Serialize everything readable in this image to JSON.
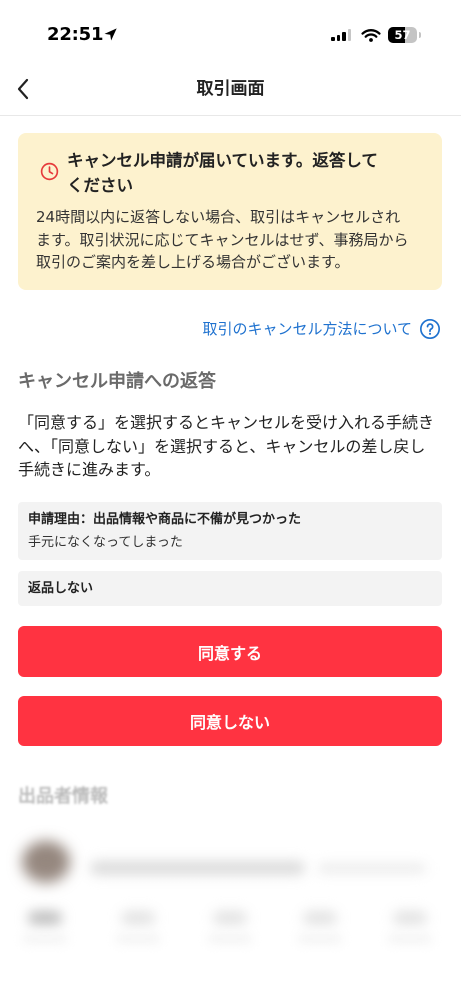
{
  "status_bar": {
    "time": "22:51",
    "battery": "57",
    "icons": [
      "location-arrow-icon",
      "cellular-signal-icon",
      "wifi-icon",
      "battery-icon"
    ]
  },
  "header": {
    "title": "取引画面",
    "back_icon": "chevron-left-icon"
  },
  "notice": {
    "icon": "clock-icon",
    "title_lines": [
      "キャンセル申請が届いています。返答して",
      "ください"
    ],
    "body_lines": [
      "24時間以内に返答しない場合、取引はキャンセルされ",
      "ます。取引状況に応じてキャンセルはせず、事務局から",
      "取引のご案内を差し上げる場合がございます。"
    ]
  },
  "help_link": {
    "label": "取引のキャンセル方法について",
    "icon": "question-circle-icon"
  },
  "response": {
    "heading": "キャンセル申請への返答",
    "description_lines": [
      "「同意する」を選択するとキャンセルを受け入れる手続き",
      "へ、「同意しない」を選択すると、キャンセルの差し戻し",
      "手続きに進みます。"
    ],
    "reason": {
      "label": "申請理由：出品情報や商品に不備が見つかった",
      "detail": "手元になくなってしまった"
    },
    "return_option": "返品しない",
    "agree_label": "同意する",
    "disagree_label": "同意しない"
  },
  "seller": {
    "heading": "出品者情報"
  },
  "colors": {
    "accent": "#FF3341",
    "link": "#1F72CF",
    "notice_background": "#FDF2CE",
    "notice_icon": "#E63B3B",
    "info_box_background": "#F3F3F3",
    "section_heading": "#6A6A6A"
  }
}
